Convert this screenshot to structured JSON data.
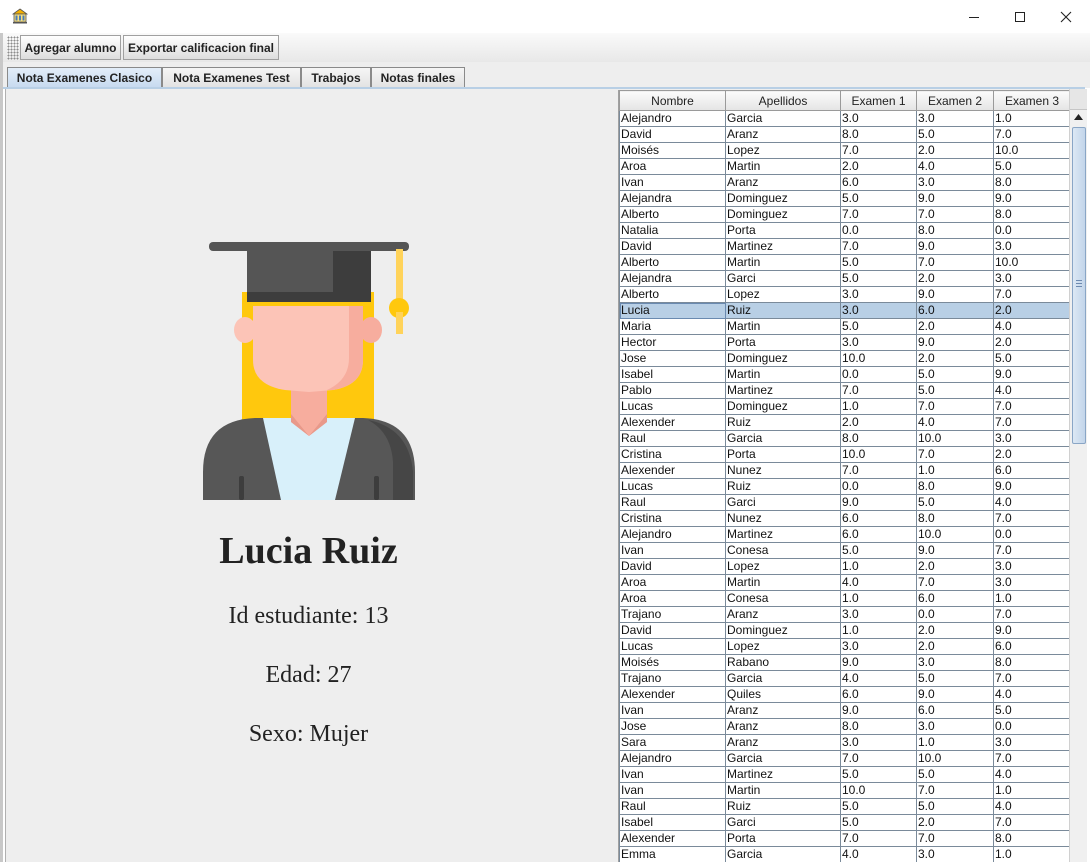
{
  "window": {
    "app_icon": "building-icon",
    "controls": [
      "minimize-icon",
      "maximize-icon",
      "close-icon"
    ]
  },
  "toolbar": {
    "add_student_label": "Agregar alumno",
    "export_label": "Exportar calificacion final"
  },
  "tabs": [
    {
      "label": "Nota Examenes Clasico",
      "active": true
    },
    {
      "label": "Nota Examenes Test",
      "active": false
    },
    {
      "label": "Trabajos",
      "active": false
    },
    {
      "label": "Notas finales",
      "active": false
    }
  ],
  "profile": {
    "avatar_icon": "graduate-student-icon",
    "name": "Lucia Ruiz",
    "student_id": "Id estudiante: 13",
    "age": "Edad: 27",
    "sex": "Sexo: Mujer"
  },
  "table": {
    "columns": [
      "Nombre",
      "Apellidos",
      "Examen 1",
      "Examen 2",
      "Examen 3"
    ],
    "selected_row": 12,
    "rows": [
      [
        "Alejandro",
        "Garcia",
        "3.0",
        "3.0",
        "1.0"
      ],
      [
        "David",
        "Aranz",
        "8.0",
        "5.0",
        "7.0"
      ],
      [
        "Moisés",
        "Lopez",
        "7.0",
        "2.0",
        "10.0"
      ],
      [
        "Aroa",
        "Martin",
        "2.0",
        "4.0",
        "5.0"
      ],
      [
        "Ivan",
        "Aranz",
        "6.0",
        "3.0",
        "8.0"
      ],
      [
        "Alejandra",
        "Dominguez",
        "5.0",
        "9.0",
        "9.0"
      ],
      [
        "Alberto",
        "Dominguez",
        "7.0",
        "7.0",
        "8.0"
      ],
      [
        "Natalia",
        "Porta",
        "0.0",
        "8.0",
        "0.0"
      ],
      [
        "David",
        "Martinez",
        "7.0",
        "9.0",
        "3.0"
      ],
      [
        "Alberto",
        "Martin",
        "5.0",
        "7.0",
        "10.0"
      ],
      [
        "Alejandra",
        "Garci",
        "5.0",
        "2.0",
        "3.0"
      ],
      [
        "Alberto",
        "Lopez",
        "3.0",
        "9.0",
        "7.0"
      ],
      [
        "Lucia",
        "Ruiz",
        "3.0",
        "6.0",
        "2.0"
      ],
      [
        "Maria",
        "Martin",
        "5.0",
        "2.0",
        "4.0"
      ],
      [
        "Hector",
        "Porta",
        "3.0",
        "9.0",
        "2.0"
      ],
      [
        "Jose",
        "Dominguez",
        "10.0",
        "2.0",
        "5.0"
      ],
      [
        "Isabel",
        "Martin",
        "0.0",
        "5.0",
        "9.0"
      ],
      [
        "Pablo",
        "Martinez",
        "7.0",
        "5.0",
        "4.0"
      ],
      [
        "Lucas",
        "Dominguez",
        "1.0",
        "7.0",
        "7.0"
      ],
      [
        "Alexender",
        "Ruiz",
        "2.0",
        "4.0",
        "7.0"
      ],
      [
        "Raul",
        "Garcia",
        "8.0",
        "10.0",
        "3.0"
      ],
      [
        "Cristina",
        "Porta",
        "10.0",
        "7.0",
        "2.0"
      ],
      [
        "Alexender",
        "Nunez",
        "7.0",
        "1.0",
        "6.0"
      ],
      [
        "Lucas",
        "Ruiz",
        "0.0",
        "8.0",
        "9.0"
      ],
      [
        "Raul",
        "Garci",
        "9.0",
        "5.0",
        "4.0"
      ],
      [
        "Cristina",
        "Nunez",
        "6.0",
        "8.0",
        "7.0"
      ],
      [
        "Alejandro",
        "Martinez",
        "6.0",
        "10.0",
        "0.0"
      ],
      [
        "Ivan",
        "Conesa",
        "5.0",
        "9.0",
        "7.0"
      ],
      [
        "David",
        "Lopez",
        "1.0",
        "2.0",
        "3.0"
      ],
      [
        "Aroa",
        "Martin",
        "4.0",
        "7.0",
        "3.0"
      ],
      [
        "Aroa",
        "Conesa",
        "1.0",
        "6.0",
        "1.0"
      ],
      [
        "Trajano",
        "Aranz",
        "3.0",
        "0.0",
        "7.0"
      ],
      [
        "David",
        "Dominguez",
        "1.0",
        "2.0",
        "9.0"
      ],
      [
        "Lucas",
        "Lopez",
        "3.0",
        "2.0",
        "6.0"
      ],
      [
        "Moisés",
        "Rabano",
        "9.0",
        "3.0",
        "8.0"
      ],
      [
        "Trajano",
        "Garcia",
        "4.0",
        "5.0",
        "7.0"
      ],
      [
        "Alexender",
        "Quiles",
        "6.0",
        "9.0",
        "4.0"
      ],
      [
        "Ivan",
        "Aranz",
        "9.0",
        "6.0",
        "5.0"
      ],
      [
        "Jose",
        "Aranz",
        "8.0",
        "3.0",
        "0.0"
      ],
      [
        "Sara",
        "Aranz",
        "3.0",
        "1.0",
        "3.0"
      ],
      [
        "Alejandro",
        "Garcia",
        "7.0",
        "10.0",
        "7.0"
      ],
      [
        "Ivan",
        "Martinez",
        "5.0",
        "5.0",
        "4.0"
      ],
      [
        "Ivan",
        "Martin",
        "10.0",
        "7.0",
        "1.0"
      ],
      [
        "Raul",
        "Ruiz",
        "5.0",
        "5.0",
        "4.0"
      ],
      [
        "Isabel",
        "Garci",
        "5.0",
        "2.0",
        "7.0"
      ],
      [
        "Alexender",
        "Porta",
        "7.0",
        "7.0",
        "8.0"
      ],
      [
        "Emma",
        "Garcia",
        "4.0",
        "3.0",
        "1.0"
      ]
    ]
  },
  "colors": {
    "selection": "#b8cfe5",
    "panel_bg": "#eeeeee",
    "cap": "#555555",
    "tassel": "#ffd35a",
    "hair": "#ffc80d",
    "skin": "#fcc4b7",
    "gown": "#575757",
    "shirt": "#d8f0fa"
  }
}
